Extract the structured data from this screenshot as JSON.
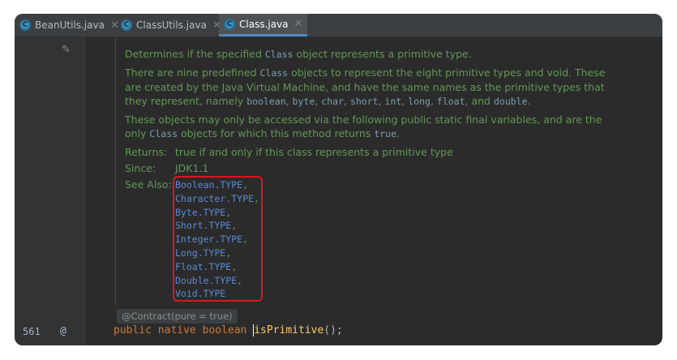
{
  "tabs": [
    {
      "label": "BeanUtils.java",
      "active": false
    },
    {
      "label": "ClassUtils.java",
      "active": false
    },
    {
      "label": "Class.java",
      "active": true
    }
  ],
  "doc": {
    "summary_pre": "Determines if the specified ",
    "summary_code": "Class",
    "summary_post": " object represents a primitive type.",
    "p2_a": "There are nine predefined ",
    "p2_code1": "Class",
    "p2_b": " objects to represent the eight primitive types and void. These are created by the Java Virtual Machine, and have the same names as the primitive types that they represent, namely ",
    "p2_codes": [
      "boolean",
      "byte",
      "char",
      "short",
      "int",
      "long",
      "float"
    ],
    "p2_and": ", and ",
    "p2_last": "double",
    "p3_a": "These objects may only be accessed via the following public static final variables, and are the only ",
    "p3_code1": "Class",
    "p3_b": " objects for which this method returns ",
    "p3_code2": "true",
    "returns_label": "Returns:",
    "returns_value": "true if and only if this class represents a primitive type",
    "since_label": "Since:",
    "since_value": "JDK1.1",
    "seealso_label": "See Also:",
    "seealso": [
      "Boolean.TYPE",
      "Character.TYPE",
      "Byte.TYPE",
      "Short.TYPE",
      "Integer.TYPE",
      "Long.TYPE",
      "Float.TYPE",
      "Double.TYPE",
      "Void.TYPE"
    ]
  },
  "editor": {
    "line_number": "561",
    "gutter_marker": "@",
    "annotation": "@Contract(pure = true)",
    "code_kw": "public native boolean ",
    "code_fn": "isPrimitive",
    "code_tail": "();"
  },
  "colors": {
    "accent": "#4a88c7",
    "highlight_box": "#e0141e",
    "doc_text": "#629755",
    "link": "#5b8ad6"
  }
}
